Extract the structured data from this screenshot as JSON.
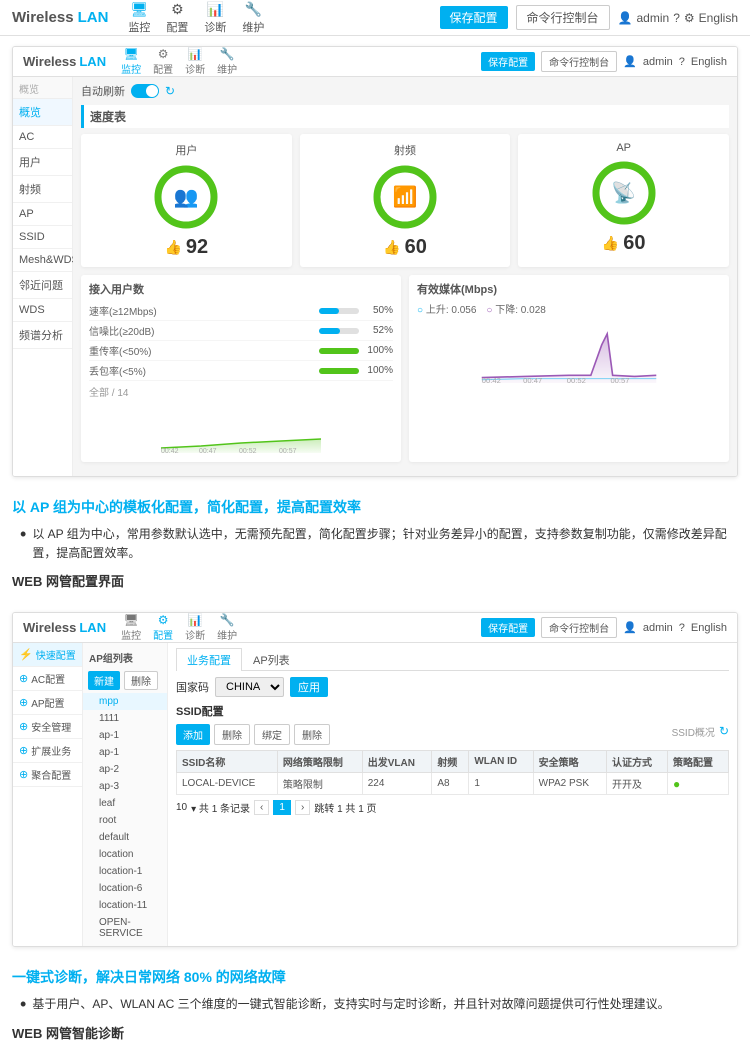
{
  "header": {
    "logo_wireless": "Wireless",
    "logo_lan": "LAN",
    "nav_items": [
      {
        "label": "监控",
        "icon": "🖥",
        "active": true
      },
      {
        "label": "配置",
        "icon": "⚙"
      },
      {
        "label": "诊断",
        "icon": "📊"
      },
      {
        "label": "维护",
        "icon": "🔧"
      }
    ],
    "btn_save": "保存配置",
    "btn_cmd": "命令行控制台",
    "user": "admin",
    "lang": "English"
  },
  "screenshot1": {
    "header": {
      "logo_wireless": "Wireless",
      "logo_lan": "LAN",
      "btn_save": "保存配置",
      "btn_cmd": "命令行控制台",
      "user": "admin",
      "lang": "English"
    },
    "sidebar_section": "概览",
    "sidebar_items": [
      "概览",
      "AC",
      "用户",
      "射频",
      "AP",
      "SSID",
      "Mesh&WDS",
      "邻近问题",
      "WDS",
      "频谱分析"
    ],
    "auto_refresh_label": "自动刷新",
    "section_speed": "速度表",
    "donuts": [
      {
        "label": "用户",
        "value": 92,
        "icon": "👥",
        "color": "#52c41a"
      },
      {
        "label": "射频",
        "value": 60,
        "icon": "📶",
        "color": "#52c41a"
      },
      {
        "label": "AP",
        "value": 60,
        "icon": "📡",
        "color": "#52c41a"
      }
    ],
    "stats": {
      "users_title": "接入用户数",
      "users_total": "全部 / 14",
      "users_rows": [
        {
          "label": "速率(≥12Mbps)",
          "pct": "50%",
          "bar": 50
        },
        {
          "label": "信噪比(≥20dB)",
          "pct": "52%",
          "bar": 52
        },
        {
          "label": "重传率(<50%)",
          "pct": "100%",
          "bar": 100
        },
        {
          "label": "丢包率(<5%)",
          "pct": "100%",
          "bar": 100
        }
      ],
      "ap_title": "有效媒体(Mbps)",
      "ap_rows": [
        {
          "label": "上升: 0.056",
          "label2": "下降: 0.028"
        }
      ]
    },
    "chart_xaxis": [
      "00:42",
      "00:47",
      "00:52",
      "00:57"
    ]
  },
  "section1": {
    "title": "以 AP 组为中心的模板化配置，简化配置，提高配置效率",
    "bullet": "以 AP 组为中心，常用参数默认选中，无需预先配置，简化配置步骤；针对业务差异小的配置，支持参数复制功能，仅需修改差异配置，提高配置效率。",
    "web_label": "WEB 网管配置界面"
  },
  "screenshot2": {
    "header": {
      "logo_wireless": "Wireless",
      "logo_lan": "LAN",
      "btn_save": "保存配置",
      "btn_cmd": "命令行控制台",
      "user": "admin",
      "lang": "English"
    },
    "sidebar_items": [
      {
        "label": "快速配置",
        "icon": "⚡",
        "active": true
      },
      {
        "label": "AC配置",
        "icon": "⊕"
      },
      {
        "label": "AP配置",
        "icon": "⊕"
      },
      {
        "label": "安全管理",
        "icon": "⊕"
      },
      {
        "label": "扩展业务",
        "icon": "⊕"
      },
      {
        "label": "聚合配置",
        "icon": "⊕"
      }
    ],
    "tree_buttons": [
      "新建",
      "删除"
    ],
    "tree_items": [
      {
        "label": "AP组列表",
        "indent": false
      },
      {
        "label": "mpp",
        "indent": true
      },
      {
        "label": "1111",
        "indent": true
      },
      {
        "label": "ap-1",
        "indent": true
      },
      {
        "label": "ap-1",
        "indent": true
      },
      {
        "label": "ap-2",
        "indent": true
      },
      {
        "label": "ap-3",
        "indent": true
      },
      {
        "label": "leaf",
        "indent": true
      },
      {
        "label": "root",
        "indent": true
      },
      {
        "label": "default",
        "indent": true
      },
      {
        "label": "location",
        "indent": true
      },
      {
        "label": "location-1",
        "indent": true
      },
      {
        "label": "location-6",
        "indent": true
      },
      {
        "label": "location-11",
        "indent": true
      },
      {
        "label": "OPEN-SERVICE",
        "indent": true
      }
    ],
    "tabs": [
      "业务配置",
      "AP列表"
    ],
    "country_label": "国家码",
    "country_value": "CHINA",
    "apply_label": "应用",
    "ssid_title": "SSID配置",
    "ssid_buttons": [
      "添加",
      "删除",
      "绑定",
      "删除"
    ],
    "table_headers": [
      "SSID名称",
      "网络策略限制",
      "出发VLAN",
      "射频",
      "WLAN ID",
      "安全策略",
      "认证方式",
      "策略配置"
    ],
    "table_rows": [
      {
        "ssid": "LOCAL-DEVICE",
        "policy": "策略限制",
        "vlan": "224",
        "radio": "A8",
        "wlan_id": "1",
        "security": "WPA2 PSK",
        "auth": "开开及",
        "status": "green"
      }
    ],
    "per_page": "10",
    "total": "共 1 条记录",
    "page_num": "1",
    "total_pages": "共 1 页"
  },
  "section2": {
    "title": "一键式诊断，解决日常网络 80% 的网络故障",
    "bullet": "基于用户、AP、WLAN AC 三个维度的一键式智能诊断，支持实时与定时诊断，并且针对故障问题提供可行性处理建议。",
    "web_label": "WEB 网管智能诊断"
  }
}
